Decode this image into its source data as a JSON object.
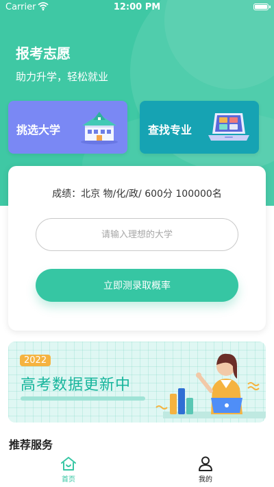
{
  "status_bar": {
    "carrier": "Carrier",
    "time": "12:00 PM"
  },
  "header": {
    "title": "报考志愿",
    "subtitle": "助力升学，轻松就业"
  },
  "entries": [
    {
      "label": "挑选大学",
      "icon": "school-building-icon",
      "color": "#7a88f4"
    },
    {
      "label": "查找专业",
      "icon": "laptop-icon",
      "color": "#16a3b3"
    }
  ],
  "main": {
    "score_text": "成绩：北京 物/化/政/ 600分 100000名",
    "university_input": {
      "placeholder": "请输入理想的大学",
      "value": ""
    },
    "test_button_label": "立即测录取概率",
    "accent_color": "#36c6a3"
  },
  "banner": {
    "year": "2022",
    "headline": "高考数据更新中"
  },
  "recommend": {
    "title": "推荐服务"
  },
  "tab_bar": {
    "items": [
      {
        "label": "首页",
        "icon": "home-icon",
        "active": true
      },
      {
        "label": "我的",
        "icon": "user-icon",
        "active": false
      }
    ]
  }
}
